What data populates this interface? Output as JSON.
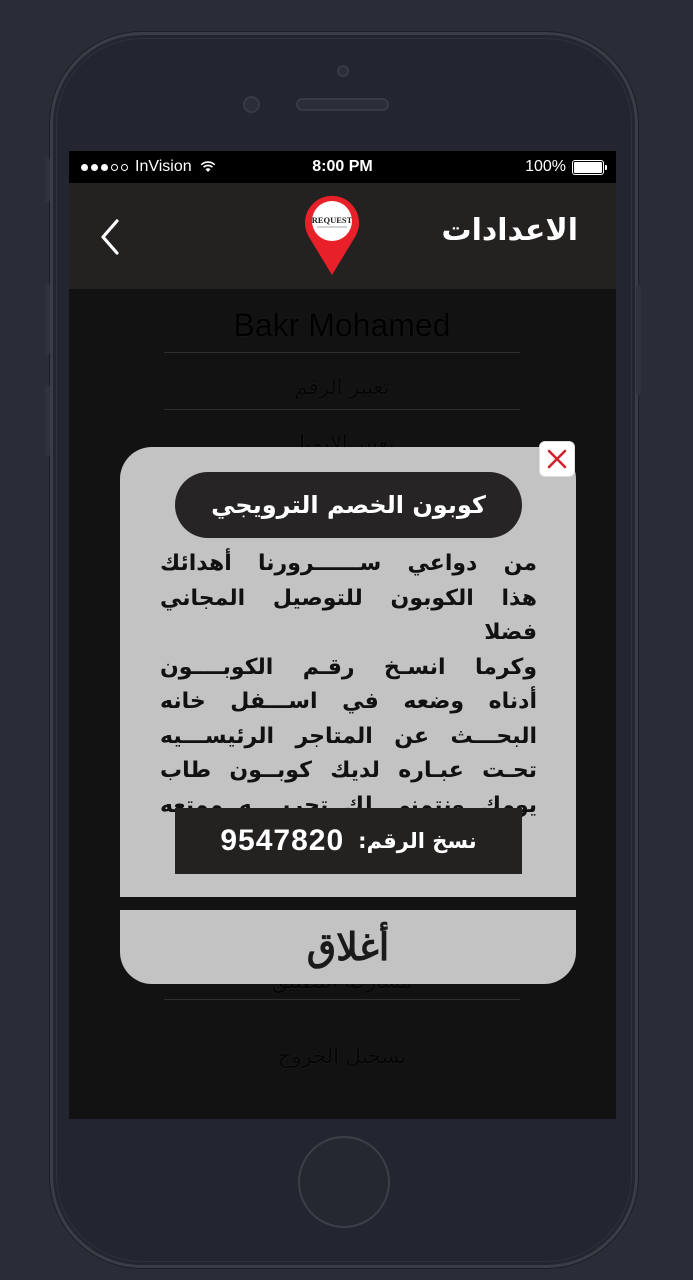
{
  "status_bar": {
    "carrier": "InVision",
    "time": "8:00 PM",
    "battery": "100%"
  },
  "header": {
    "title": "الاعدادات",
    "logo_text": "REQUEST",
    "accent_color": "#e8202a"
  },
  "settings": {
    "profile_name": "Bakr Mohamed",
    "items": [
      {
        "label": "تغيير الرقم"
      },
      {
        "label": "تغيير الايميل"
      },
      {
        "label": "مشاركة التطبيق"
      },
      {
        "label": "تسجيل الخروج"
      }
    ]
  },
  "coupon_modal": {
    "title": "كوبون الخصم الترويجي",
    "body_lines": [
      "من دواعي ســــــرورنا أهدائك",
      "هذا الكوبون للتوصيل المجاني فضلا",
      "وكرما انسـخ رقـم الكوبــــون",
      "أدناه وضعه في اســـفل خانه",
      "البحـــث عن المتاجر الرئيســـيه",
      "تحـت عبـاره لديك كوبــون طاب",
      "يومك ونتمنى لك تجربــــه ممتعه"
    ],
    "code_label": "نسخ الرقم:",
    "code_value": "9547820",
    "close_label": "أغلاق",
    "close_icon": "close-x-icon"
  }
}
